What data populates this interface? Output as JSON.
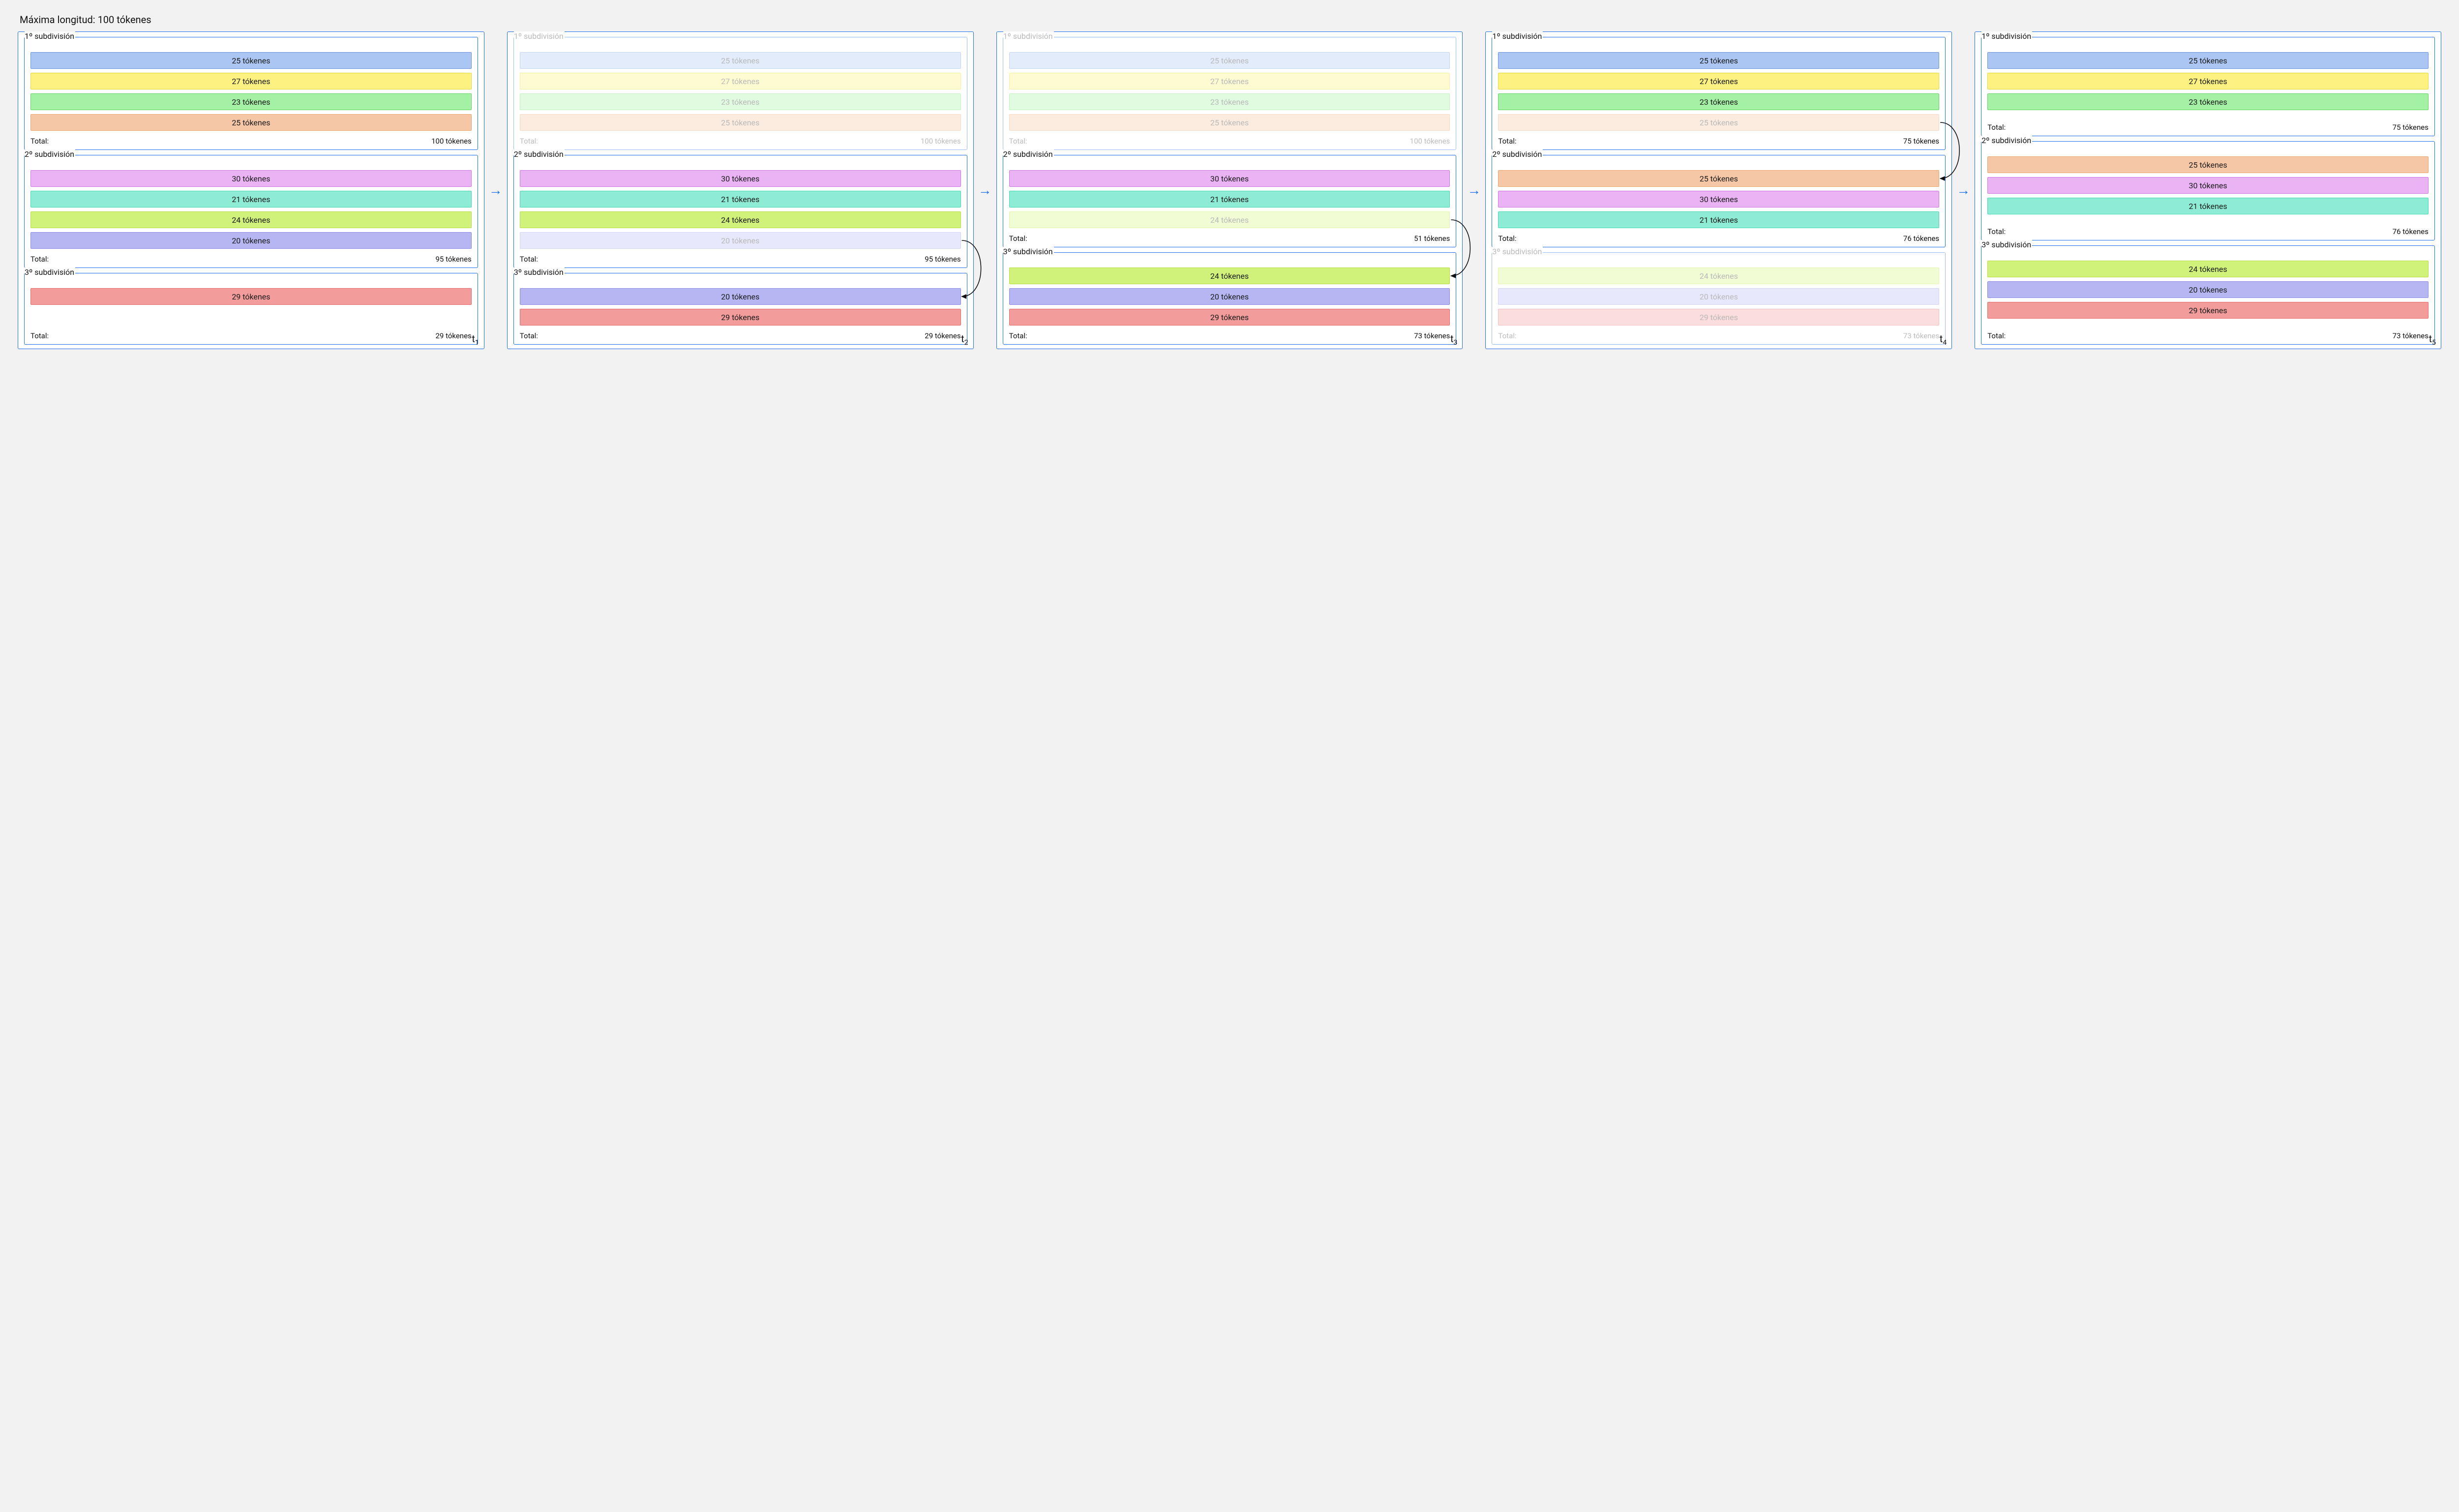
{
  "title": "Máxima longitud: 100 tókenes",
  "labels": {
    "sub1": "1º subdivisión",
    "sub2": "2º subdivisión",
    "sub3": "3º subdivisión",
    "total": "Total:",
    "unit": "tókenes"
  },
  "timesteps": [
    "t1",
    "t2",
    "t3",
    "t4",
    "t5"
  ],
  "columns": [
    {
      "id": "t1",
      "sub1": {
        "faded": false,
        "tokens": [
          {
            "v": "25 tókenes",
            "c": "blue"
          },
          {
            "v": "27 tókenes",
            "c": "yellow"
          },
          {
            "v": "23 tókenes",
            "c": "green"
          },
          {
            "v": "25 tókenes",
            "c": "salmon"
          }
        ],
        "total": "100 tókenes"
      },
      "sub2": {
        "faded": false,
        "tokens": [
          {
            "v": "30 tókenes",
            "c": "pink"
          },
          {
            "v": "21 tókenes",
            "c": "mint"
          },
          {
            "v": "24 tókenes",
            "c": "lime"
          },
          {
            "v": "20 tókenes",
            "c": "violet"
          }
        ],
        "total": "95 tókenes"
      },
      "sub3": {
        "faded": false,
        "tokens": [
          {
            "v": "29 tókenes",
            "c": "red"
          }
        ],
        "total": "29 tókenes"
      }
    },
    {
      "id": "t2",
      "sub1": {
        "faded": true,
        "tokens": [
          {
            "v": "25 tókenes",
            "c": "blue",
            "faded": true
          },
          {
            "v": "27 tókenes",
            "c": "yellow",
            "faded": true
          },
          {
            "v": "23 tókenes",
            "c": "green",
            "faded": true
          },
          {
            "v": "25 tókenes",
            "c": "salmon",
            "faded": true
          }
        ],
        "total": "100 tókenes"
      },
      "sub2": {
        "faded": false,
        "tokens": [
          {
            "v": "30 tókenes",
            "c": "pink"
          },
          {
            "v": "21 tókenes",
            "c": "mint"
          },
          {
            "v": "24 tókenes",
            "c": "lime"
          },
          {
            "v": "20 tókenes",
            "c": "violet",
            "faded": true
          }
        ],
        "total": "95 tókenes"
      },
      "sub3": {
        "faded": false,
        "tokens": [
          {
            "v": "20 tókenes",
            "c": "violet"
          },
          {
            "v": "29 tókenes",
            "c": "red"
          }
        ],
        "total": "29 tókenes"
      }
    },
    {
      "id": "t3",
      "sub1": {
        "faded": true,
        "tokens": [
          {
            "v": "25 tókenes",
            "c": "blue",
            "faded": true
          },
          {
            "v": "27 tókenes",
            "c": "yellow",
            "faded": true
          },
          {
            "v": "23 tókenes",
            "c": "green",
            "faded": true
          },
          {
            "v": "25 tókenes",
            "c": "salmon",
            "faded": true
          }
        ],
        "total": "100 tókenes"
      },
      "sub2": {
        "faded": false,
        "tokens": [
          {
            "v": "30 tókenes",
            "c": "pink"
          },
          {
            "v": "21 tókenes",
            "c": "mint"
          },
          {
            "v": "24 tókenes",
            "c": "lime",
            "faded": true
          }
        ],
        "total": "51 tókenes"
      },
      "sub3": {
        "faded": false,
        "tokens": [
          {
            "v": "24 tókenes",
            "c": "lime"
          },
          {
            "v": "20 tókenes",
            "c": "violet"
          },
          {
            "v": "29 tókenes",
            "c": "red"
          }
        ],
        "total": "73 tókenes"
      }
    },
    {
      "id": "t4",
      "sub1": {
        "faded": false,
        "tokens": [
          {
            "v": "25 tókenes",
            "c": "blue"
          },
          {
            "v": "27 tókenes",
            "c": "yellow"
          },
          {
            "v": "23 tókenes",
            "c": "green"
          },
          {
            "v": "25 tókenes",
            "c": "salmon",
            "faded": true
          }
        ],
        "total": "75 tókenes"
      },
      "sub2": {
        "faded": false,
        "tokens": [
          {
            "v": "25 tókenes",
            "c": "salmon"
          },
          {
            "v": "30 tókenes",
            "c": "pink"
          },
          {
            "v": "21 tókenes",
            "c": "mint"
          }
        ],
        "total": "76 tókenes"
      },
      "sub3": {
        "faded": true,
        "tokens": [
          {
            "v": "24 tókenes",
            "c": "lime",
            "faded": true
          },
          {
            "v": "20 tókenes",
            "c": "violet",
            "faded": true
          },
          {
            "v": "29 tókenes",
            "c": "red",
            "faded": true
          }
        ],
        "total": "73 tókenes"
      }
    },
    {
      "id": "t5",
      "sub1": {
        "faded": false,
        "tokens": [
          {
            "v": "25 tókenes",
            "c": "blue"
          },
          {
            "v": "27 tókenes",
            "c": "yellow"
          },
          {
            "v": "23 tókenes",
            "c": "green"
          }
        ],
        "total": "75 tókenes"
      },
      "sub2": {
        "faded": false,
        "tokens": [
          {
            "v": "25 tókenes",
            "c": "salmon"
          },
          {
            "v": "30 tókenes",
            "c": "pink"
          },
          {
            "v": "21 tókenes",
            "c": "mint"
          }
        ],
        "total": "76 tókenes"
      },
      "sub3": {
        "faded": false,
        "tokens": [
          {
            "v": "24 tókenes",
            "c": "lime"
          },
          {
            "v": "20 tókenes",
            "c": "violet"
          },
          {
            "v": "29 tókenes",
            "c": "red"
          }
        ],
        "total": "73 tókenes"
      }
    }
  ],
  "curves": [
    {
      "from": {
        "col": 1,
        "sub": "sub2",
        "tok": 3
      },
      "to": {
        "col": 1,
        "sub": "sub3",
        "tok": 0
      }
    },
    {
      "from": {
        "col": 2,
        "sub": "sub2",
        "tok": 2
      },
      "to": {
        "col": 2,
        "sub": "sub3",
        "tok": 0
      }
    },
    {
      "from": {
        "col": 3,
        "sub": "sub1",
        "tok": 3
      },
      "to": {
        "col": 3,
        "sub": "sub2",
        "tok": 0
      }
    }
  ]
}
